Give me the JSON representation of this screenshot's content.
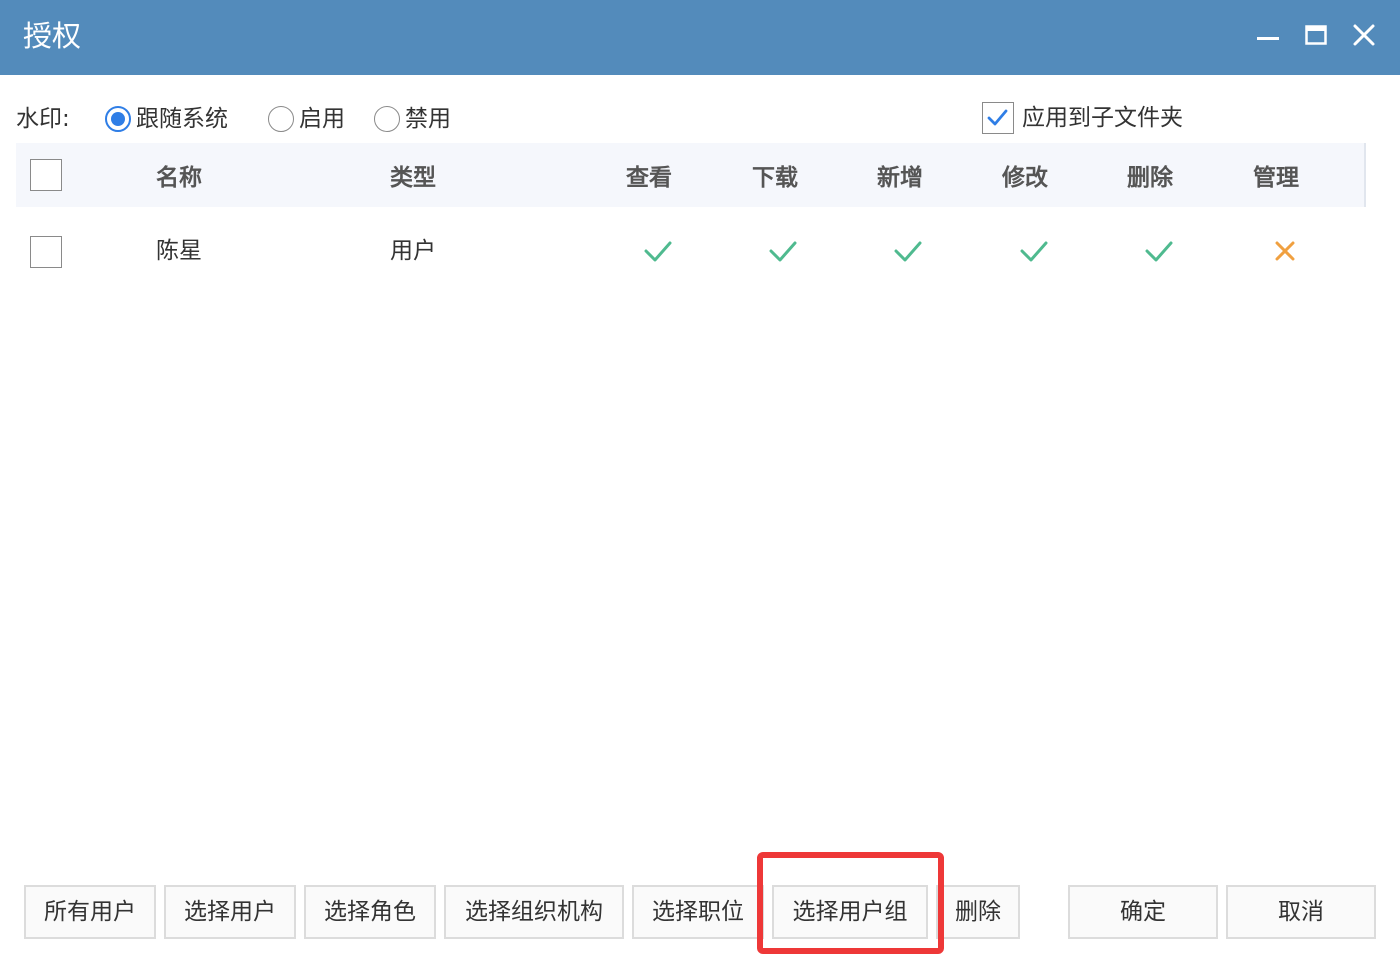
{
  "window": {
    "title": "授权",
    "titlebar_color": "#538bbb",
    "controls": [
      "minimize-icon",
      "maximize-icon",
      "close-icon"
    ]
  },
  "watermark": {
    "label": "水印:",
    "options": [
      {
        "label": "跟随系统",
        "selected": true
      },
      {
        "label": "启用",
        "selected": false
      },
      {
        "label": "禁用",
        "selected": false
      }
    ]
  },
  "apply_subfolders": {
    "label": "应用到子文件夹",
    "checked": true
  },
  "table": {
    "columns": [
      "名称",
      "类型",
      "查看",
      "下载",
      "新增",
      "修改",
      "删除",
      "管理"
    ],
    "rows": [
      {
        "name": "陈星",
        "type": "用户",
        "permissions": [
          true,
          true,
          true,
          true,
          true,
          false
        ]
      }
    ]
  },
  "buttons": {
    "all_users": "所有用户",
    "select_user": "选择用户",
    "select_role": "选择角色",
    "select_org": "选择组织机构",
    "select_position": "选择职位",
    "select_user_group": "选择用户组",
    "delete": "删除",
    "confirm": "确定",
    "cancel": "取消"
  },
  "colors": {
    "check": "#4fba8f",
    "cross": "#f0a040",
    "accent": "#2f7ee6",
    "highlight": "#ee3838"
  }
}
